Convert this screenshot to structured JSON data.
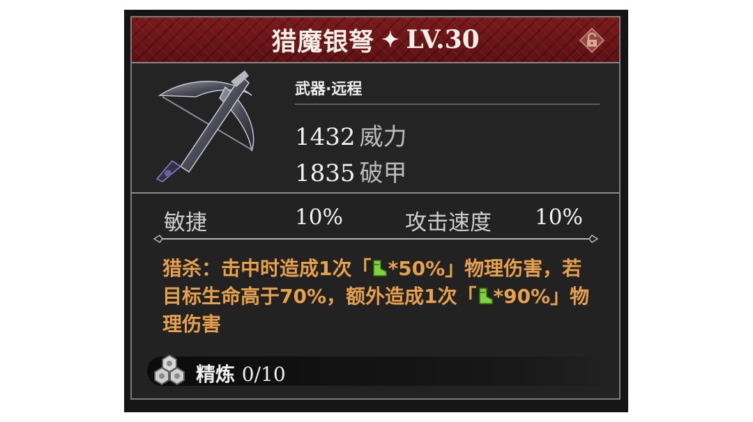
{
  "item": {
    "name": "猎魔银弩",
    "level": "LV.30",
    "category": "武器·远程",
    "stats": [
      {
        "value": "1432",
        "label": "威力"
      },
      {
        "value": "1835",
        "label": "破甲"
      }
    ],
    "sub_stats": [
      {
        "label": "敏捷",
        "value": "10%"
      },
      {
        "label": "攻击速度",
        "value": "10%"
      }
    ],
    "effect": {
      "prefix": "猎杀：击中时造成1次「",
      "mid1": "*50%」物理伤害，若目标生命高于70%，额外造成1次「",
      "mid2": "*90%」物理伤害"
    },
    "refine": {
      "label": "精炼",
      "value": "0/10"
    }
  },
  "icons": {
    "lock": "unlock-icon",
    "star": "star-icon",
    "refine": "refine-icon",
    "agility": "boot-icon"
  },
  "colors": {
    "header": "#6b1517",
    "effect_text": "#e7a04b",
    "agility_icon": "#7fd43a"
  }
}
